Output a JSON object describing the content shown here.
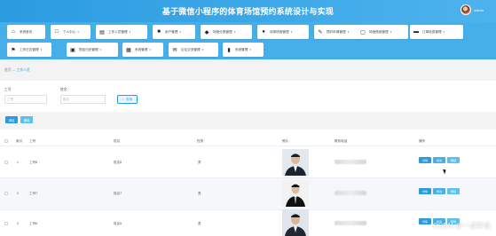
{
  "header": {
    "title": "基于微信小程序的体育场馆预约系统设计与实现",
    "username": "admin",
    "avatar_icon": "user-avatar"
  },
  "nav": {
    "items": [
      {
        "label": "系统首页",
        "icon": "home-icon"
      },
      {
        "label": "个人中心",
        "icon": "person-icon"
      },
      {
        "label": "工作人员管理",
        "icon": "staff-icon"
      },
      {
        "label": "用户管理",
        "icon": "user-icon"
      },
      {
        "label": "场馆分类管理",
        "icon": "category-icon"
      },
      {
        "label": "体育场馆管理",
        "icon": "venue-icon"
      },
      {
        "label": "预约申请管理",
        "icon": "booking-icon"
      },
      {
        "label": "场馆借用管理",
        "icon": "borrow-icon"
      },
      {
        "label": "订单信息管理",
        "icon": "order-icon"
      },
      {
        "label": "工作日志管理",
        "icon": "flag-icon"
      },
      {
        "label": "物品归还管理",
        "icon": "return-icon"
      },
      {
        "label": "系统管理",
        "icon": "grid-icon"
      },
      {
        "label": "论坛交流管理",
        "icon": "forum-icon"
      },
      {
        "label": "系统管理",
        "icon": "chart-icon"
      }
    ]
  },
  "breadcrumb": {
    "home": "首页",
    "separator": "—",
    "current": "工作人员"
  },
  "filter": {
    "field1_label": "工号",
    "field1_placeholder": "工号",
    "field2_label": "姓名",
    "field2_placeholder": "姓名",
    "search_label": "查询"
  },
  "actions": {
    "add_label": "添加",
    "delete_label": "删除"
  },
  "table": {
    "columns": [
      "索引",
      "工号",
      "姓名",
      "性别",
      "照片",
      "联系电话",
      "操作"
    ],
    "rows": [
      {
        "index": "1",
        "id": "工号8",
        "name": "姓名8",
        "gender": "男"
      },
      {
        "index": "2",
        "id": "工号7",
        "name": "姓名7",
        "gender": "男"
      },
      {
        "index": "3",
        "id": "工号6",
        "name": "姓名6",
        "gender": "男"
      }
    ],
    "op_detail": "详情",
    "op_edit": "修改",
    "op_delete": "删除"
  },
  "watermark": "CSDN @一点毕设",
  "colors": {
    "primary": "#2b9be0",
    "nav_bg": "#46aee9",
    "light": "#5bc0ee"
  }
}
